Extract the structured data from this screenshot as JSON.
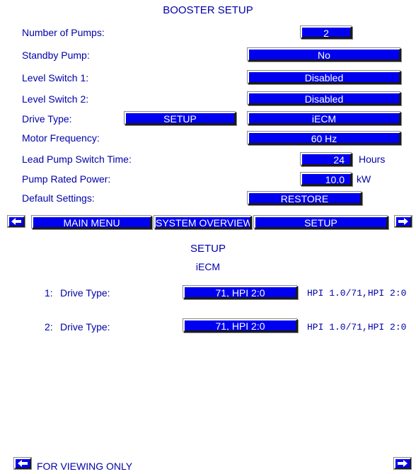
{
  "header": {
    "title": "BOOSTER SETUP"
  },
  "settings": {
    "number_of_pumps": {
      "label": "Number of Pumps:",
      "value": "2"
    },
    "standby_pump": {
      "label": "Standby Pump:",
      "value": "No"
    },
    "level_switch_1": {
      "label": "Level Switch 1:",
      "value": "Disabled"
    },
    "level_switch_2": {
      "label": "Level Switch 2:",
      "value": "Disabled"
    },
    "drive_type": {
      "label": "Drive Type:",
      "button": "SETUP",
      "value": "iECM"
    },
    "motor_frequency": {
      "label": "Motor Frequency:",
      "value": "60 Hz"
    },
    "lead_pump_switch_time": {
      "label": "Lead Pump Switch Time:",
      "value": "24",
      "unit": "Hours"
    },
    "pump_rated_power": {
      "label": "Pump Rated Power:",
      "value": "10.0",
      "unit": "kW"
    },
    "default_settings": {
      "label": "Default Settings:",
      "button": "RESTORE"
    }
  },
  "nav": {
    "main_menu": "MAIN MENU",
    "system_overview": "SYSTEM OVERVIEW",
    "setup": "SETUP"
  },
  "setup_panel": {
    "title": "SETUP",
    "subtitle": "iECM",
    "rows": [
      {
        "index": "1:",
        "label": "Drive Type:",
        "value": "71, HPI 2:0",
        "options": "HPI 1.0/71,HPI 2:0"
      },
      {
        "index": "2:",
        "label": "Drive Type:",
        "value": "71, HPI 2:0",
        "options": "HPI 1.0/71,HPI 2:0"
      }
    ]
  },
  "footer": {
    "notice": "FOR VIEWING ONLY"
  },
  "icons": {
    "prev": "left-arrow-icon",
    "next": "right-arrow-icon"
  },
  "colors": {
    "button": "#0000f0",
    "text": "#0000a8",
    "background": "#ffffff"
  }
}
